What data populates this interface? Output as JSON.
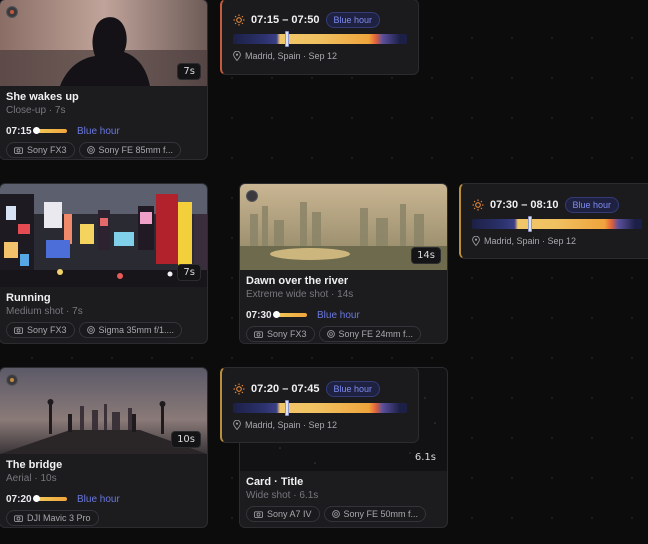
{
  "cards": [
    {
      "title": "She wakes up",
      "subtitle": "Close-up · 7s",
      "duration": "7s",
      "time": "07:15",
      "tag": "Blue hour",
      "chips": [
        "Sony FX3",
        "Sony FE 85mm f..."
      ]
    },
    {
      "title": "Running",
      "subtitle": "Medium shot · 7s",
      "duration": "7s",
      "chips": [
        "Sony FX3",
        "Sigma 35mm f/1...."
      ]
    },
    {
      "title": "Dawn over the river",
      "subtitle": "Extreme wide shot · 14s",
      "duration": "14s",
      "time": "07:30",
      "tag": "Blue hour",
      "chips": [
        "Sony FX3",
        "Sony FE 24mm f..."
      ]
    },
    {
      "title": "The bridge",
      "subtitle": "Aerial · 10s",
      "duration": "10s",
      "time": "07:20",
      "tag": "Blue hour",
      "chips": [
        "DJI Mavic 3 Pro"
      ]
    },
    {
      "title": "Card · Title",
      "subtitle": "Wide shot · 6.1s",
      "duration": "6.1s",
      "chips": [
        "Sony A7 IV",
        "Sony FE 50mm f..."
      ]
    }
  ],
  "popovers": [
    {
      "range": "07:15 – 07:50",
      "badge": "Blue hour",
      "location": "Madrid, Spain · Sep 12"
    },
    {
      "range": "07:30 – 08:10",
      "badge": "Blue hour",
      "location": "Madrid, Spain · Sep 12"
    },
    {
      "range": "07:20 – 07:45",
      "badge": "Blue hour",
      "location": "Madrid, Spain · Sep 12"
    }
  ],
  "icons": {
    "sun": "sun-icon",
    "pin": "map-pin-icon",
    "camera": "camera-icon",
    "lens": "lens-icon"
  },
  "colors": {
    "accent_amber": "#f0c060",
    "blue_hour": "#6a78e0",
    "background": "#0c0c0d"
  }
}
